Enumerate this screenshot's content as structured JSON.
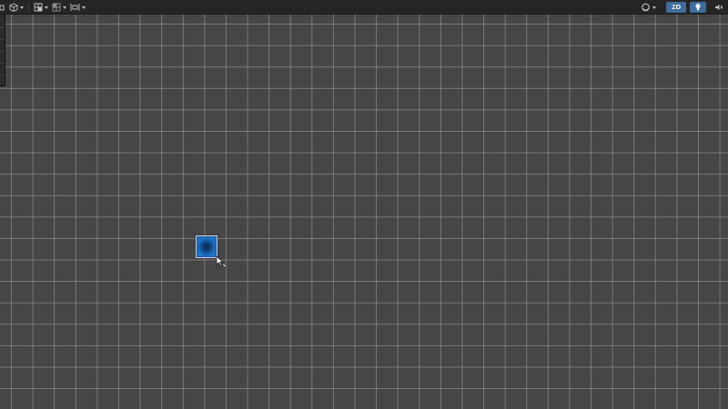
{
  "toolbar": {
    "left_tools": [
      {
        "icon": "gizmo-icon",
        "dropdown": false
      },
      {
        "icon": "cube-icon",
        "dropdown": true
      },
      {
        "icon": "grid-snap-icon",
        "dropdown": true
      },
      {
        "icon": "increment-snap-icon",
        "dropdown": true
      },
      {
        "icon": "align-icon",
        "dropdown": true
      }
    ],
    "right_tools": {
      "shading_icon": "shading-sphere-icon",
      "toggle_2d_label": "2D",
      "toggle_2d_active": true,
      "lighting_icon": "lightbulb-icon",
      "lighting_active": true,
      "audio_icon": "audio-icon",
      "effects_icon": "effects-icon"
    }
  },
  "viewport": {
    "grid": true,
    "selected_object": {
      "type": "sprite",
      "color": "#1e64b0",
      "selected": true
    }
  },
  "colors": {
    "toolbar_bg": "#252526",
    "viewport_bg": "#464547",
    "grid_line": "#8a8a8b",
    "accent": "#3e6d9c"
  }
}
